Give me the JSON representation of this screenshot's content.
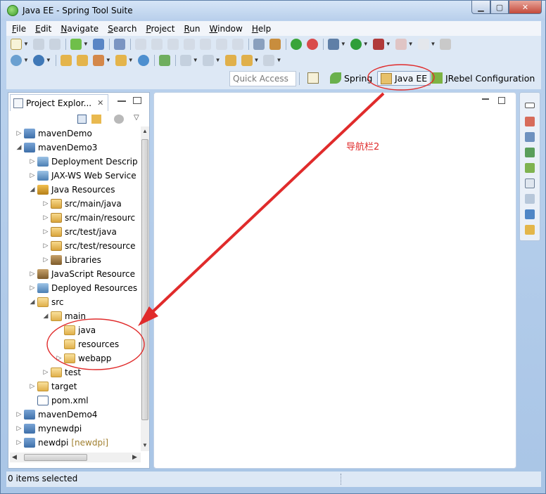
{
  "window": {
    "title": "Java EE - Spring Tool Suite"
  },
  "menubar": {
    "items": [
      "File",
      "Edit",
      "Navigate",
      "Search",
      "Project",
      "Run",
      "Window",
      "Help"
    ]
  },
  "perspective_bar": {
    "quick_access_placeholder": "Quick Access",
    "perspectives": [
      {
        "label": "Spring"
      },
      {
        "label": "Java EE",
        "active": true
      },
      {
        "label": "JRebel Configuration"
      }
    ]
  },
  "project_explorer": {
    "tab_title": "Project Explor...",
    "tree": [
      {
        "label": "mavenDemo",
        "depth": 0,
        "expander": "collapsed",
        "icon": "project"
      },
      {
        "label": "mavenDemo3",
        "depth": 0,
        "expander": "expanded",
        "icon": "project"
      },
      {
        "label": "Deployment Descrip",
        "depth": 1,
        "expander": "collapsed",
        "icon": "web"
      },
      {
        "label": "JAX-WS Web Service",
        "depth": 1,
        "expander": "collapsed",
        "icon": "web"
      },
      {
        "label": "Java Resources",
        "depth": 1,
        "expander": "expanded",
        "icon": "jres"
      },
      {
        "label": "src/main/java",
        "depth": 2,
        "expander": "collapsed",
        "icon": "pkg"
      },
      {
        "label": "src/main/resourc",
        "depth": 2,
        "expander": "collapsed",
        "icon": "pkg"
      },
      {
        "label": "src/test/java",
        "depth": 2,
        "expander": "collapsed",
        "icon": "pkg"
      },
      {
        "label": "src/test/resource",
        "depth": 2,
        "expander": "collapsed",
        "icon": "pkg"
      },
      {
        "label": "Libraries",
        "depth": 2,
        "expander": "collapsed",
        "icon": "lib"
      },
      {
        "label": "JavaScript Resource",
        "depth": 1,
        "expander": "collapsed",
        "icon": "lib"
      },
      {
        "label": "Deployed Resources",
        "depth": 1,
        "expander": "collapsed",
        "icon": "web"
      },
      {
        "label": "src",
        "depth": 1,
        "expander": "expanded",
        "icon": "folder"
      },
      {
        "label": "main",
        "depth": 2,
        "expander": "expanded",
        "icon": "folder"
      },
      {
        "label": "java",
        "depth": 3,
        "expander": "none",
        "icon": "folder"
      },
      {
        "label": "resources",
        "depth": 3,
        "expander": "none",
        "icon": "folder"
      },
      {
        "label": "webapp",
        "depth": 3,
        "expander": "collapsed",
        "icon": "folder"
      },
      {
        "label": "test",
        "depth": 2,
        "expander": "collapsed",
        "icon": "folder"
      },
      {
        "label": "target",
        "depth": 1,
        "expander": "collapsed",
        "icon": "folder"
      },
      {
        "label": "pom.xml",
        "depth": 1,
        "expander": "none",
        "icon": "xml"
      },
      {
        "label": "mavenDemo4",
        "depth": 0,
        "expander": "collapsed",
        "icon": "project"
      },
      {
        "label": "mynewdpi",
        "depth": 0,
        "expander": "collapsed",
        "icon": "project"
      },
      {
        "label": "newdpi",
        "decoration": "[newdpi]",
        "depth": 0,
        "expander": "collapsed",
        "icon": "project"
      }
    ]
  },
  "annotation": {
    "label": "导航栏2",
    "color": "#e02b2b"
  },
  "statusbar": {
    "text": "0 items selected"
  }
}
